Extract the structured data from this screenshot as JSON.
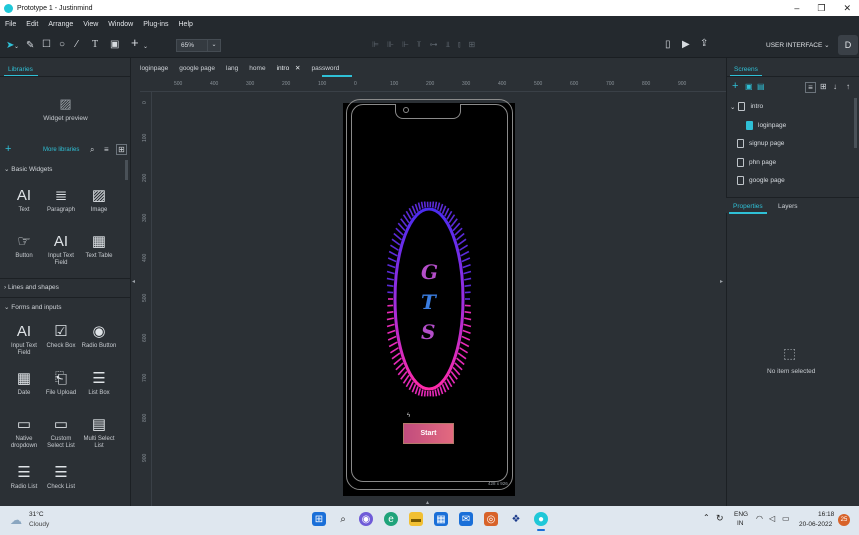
{
  "window": {
    "title": "Prototype 1 - Justinmind",
    "minimize": "–",
    "maximize": "❐",
    "close": "✕"
  },
  "menu": [
    "File",
    "Edit",
    "Arrange",
    "View",
    "Window",
    "Plug-ins",
    "Help"
  ],
  "toolbar": {
    "zoom_value": "65%",
    "zoom_drop": "⌄",
    "mode": "USER INTERFACE ⌄",
    "avatar": "D"
  },
  "left_panel": {
    "tab": "Libraries",
    "widget_preview": "Widget preview",
    "more_libraries": "More libraries",
    "add": "+",
    "sections": {
      "basic": "⌄ Basic Widgets",
      "lines": "› Lines and shapes",
      "forms": "⌄ Forms and inputs"
    },
    "basic_widgets": [
      {
        "glyph": "AI",
        "label": "Text"
      },
      {
        "glyph": "≣",
        "label": "Paragraph"
      },
      {
        "glyph": "▨",
        "label": "Image"
      },
      {
        "glyph": "☞",
        "label": "Button"
      },
      {
        "glyph": "AI",
        "label": "Input Text Field"
      },
      {
        "glyph": "▦",
        "label": "Text Table"
      }
    ],
    "form_widgets": [
      {
        "glyph": "AI",
        "label": "Input Text Field"
      },
      {
        "glyph": "☑",
        "label": "Check Box"
      },
      {
        "glyph": "◉",
        "label": "Radio Button"
      },
      {
        "glyph": "▦",
        "label": "Date"
      },
      {
        "glyph": "⎗",
        "label": "File Upload"
      },
      {
        "glyph": "☰",
        "label": "List Box"
      },
      {
        "glyph": "▭",
        "label": "Native dropdown"
      },
      {
        "glyph": "▭",
        "label": "Custom Select List"
      },
      {
        "glyph": "▤",
        "label": "Multi Select List"
      },
      {
        "glyph": "☰",
        "label": "Radio List"
      },
      {
        "glyph": "☰",
        "label": "Check List"
      }
    ]
  },
  "tabs": [
    {
      "label": "loginpage"
    },
    {
      "label": "google page"
    },
    {
      "label": "lang"
    },
    {
      "label": "home"
    },
    {
      "label": "intro",
      "close": "✕"
    },
    {
      "label": "password"
    }
  ],
  "ruler_top": [
    "500",
    "400",
    "300",
    "200",
    "100",
    "0",
    "100",
    "200",
    "300",
    "400",
    "500",
    "600",
    "700",
    "800",
    "900"
  ],
  "ruler_left": [
    "0",
    "100",
    "200",
    "300",
    "400",
    "500",
    "600",
    "700",
    "800",
    "900"
  ],
  "phone": {
    "letters": [
      "G",
      "T",
      "S"
    ],
    "start_label": "Start",
    "size_label": "428 x 926"
  },
  "right_panel": {
    "tab": "Screens",
    "screens": [
      {
        "label": "intro",
        "prefix": "⌄"
      },
      {
        "label": "loginpage"
      },
      {
        "label": "signup page"
      },
      {
        "label": "phn page"
      },
      {
        "label": "google page"
      }
    ],
    "props_tab": "Properties",
    "layers_tab": "Layers",
    "empty_text": "No item selected"
  },
  "taskbar": {
    "temp": "31°C",
    "weather": "Cloudy",
    "lang": "ENG",
    "lang_sub": "IN",
    "time": "16:18",
    "date": "20-06-2022",
    "badge": "25"
  },
  "colors": {
    "accent": "#2fc0d6",
    "ring_outer": "#5b2bd8",
    "ring_inner": "#e62ab8"
  }
}
